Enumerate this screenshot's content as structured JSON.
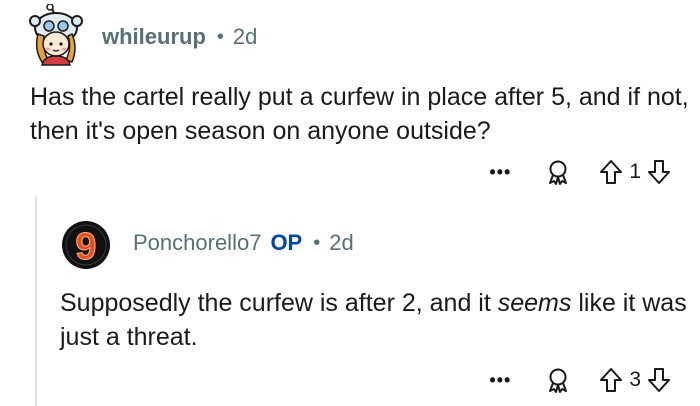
{
  "comments": [
    {
      "username": "whileurup",
      "separator": "•",
      "age": "2d",
      "body": "Has the cartel really put a curfew in place after 5, and if not, then it's open season on anyone outside?",
      "more_label": "•••",
      "vote_count": "1",
      "avatar_icon": "snoo-avatar-icon"
    },
    {
      "username": "Ponchorello7",
      "op_label": "OP",
      "separator": "•",
      "age": "2d",
      "body_before": "Supposedly the curfew is after 2, and it ",
      "body_emphasis": "seems",
      "body_after": " like it was just a threat.",
      "more_label": "•••",
      "vote_count": "3",
      "avatar_text": "9",
      "avatar_icon": "number-nine-avatar-icon"
    }
  ],
  "colors": {
    "meta": "#576f76",
    "op": "#0045ac",
    "text": "#1a1a1b",
    "thread": "#e5e5e5"
  }
}
